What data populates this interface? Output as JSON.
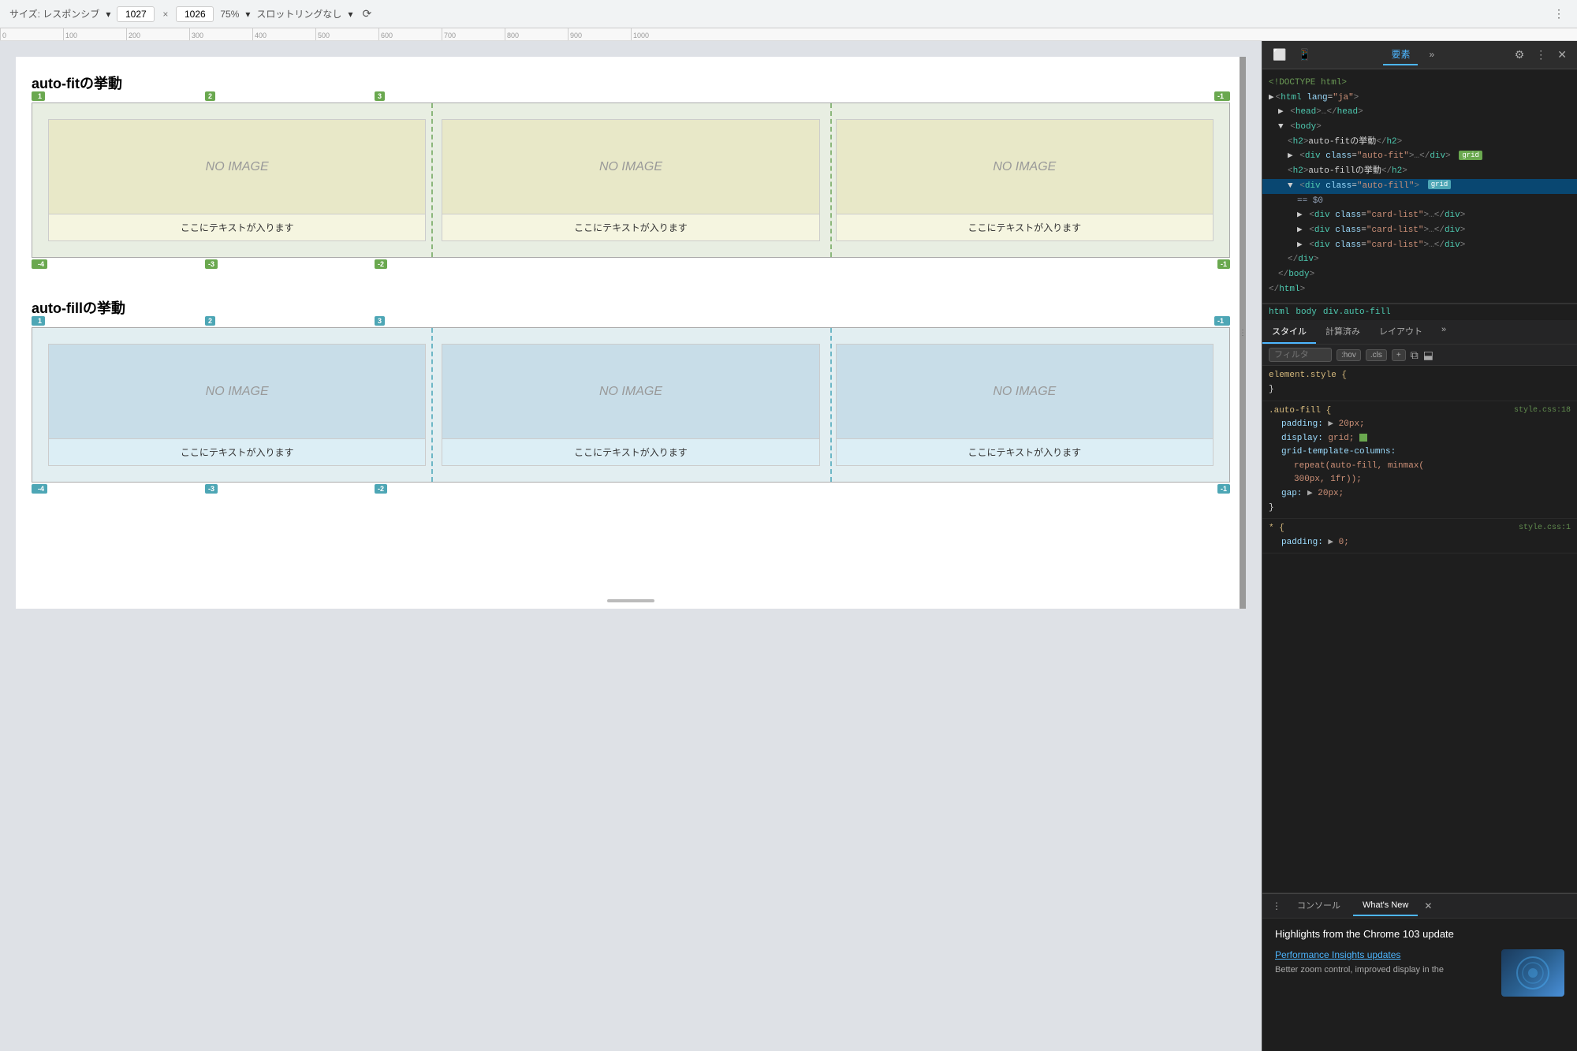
{
  "toolbar": {
    "size_label": "サイズ: レスポンシブ",
    "width_value": "1027",
    "height_value": "1026",
    "zoom_label": "75%",
    "slot_label": "スロットリングなし",
    "separator": "×"
  },
  "preview": {
    "section1_title": "auto-fitの挙動",
    "section2_title": "auto-fillの挙動",
    "card_placeholder": "NO IMAGE",
    "card_text": "ここにテキストが入ります"
  },
  "devtools": {
    "tabs": [
      "要素",
      "»"
    ],
    "icons": [
      "inspect",
      "devices",
      "settings",
      "more",
      "close"
    ],
    "html_lines": [
      "<!DOCTYPE html>",
      "<html lang=\"ja\">",
      "▶ <head>…</head>",
      "▼ <body>",
      "  <h2>auto-fitの挙動</h2>",
      "  ▶ <div class=\"auto-fit\">…</div>",
      "  <h2>auto-fillの挙動</h2>",
      "  ▼ <div class=\"auto-fill\">",
      "    == $0",
      "    ▶ <div class=\"card-list\">…</div>",
      "    ▶ <div class=\"card-list\">…</div>",
      "    ▶ <div class=\"card-list\">…</div>",
      "  </div>",
      "  </body>",
      "</html>"
    ],
    "breadcrumb": [
      "html",
      "body",
      "div.auto-fill"
    ],
    "styles_tabs": [
      "スタイル",
      "計算済み",
      "レイアウト",
      "»"
    ],
    "filter_placeholder": "フィルタ",
    "filter_badges": [
      ":hov",
      ".cls",
      "+"
    ],
    "style_rules": [
      {
        "selector": "element.style {",
        "properties": [],
        "closing": "}",
        "source": ""
      },
      {
        "selector": ".auto-fill {",
        "properties": [
          {
            "name": "padding:",
            "value": "▶ 20px;"
          },
          {
            "name": "display:",
            "value": "grid; ▪"
          },
          {
            "name": "grid-template-columns:",
            "value": ""
          },
          {
            "name": "  repeat(auto-fill, minmax(",
            "value": ""
          },
          {
            "name": "  300px, 1fr));",
            "value": ""
          },
          {
            "name": "gap:",
            "value": "▶ 20px;"
          }
        ],
        "closing": "}",
        "source": "style.css:18"
      },
      {
        "selector": "* {",
        "properties": [
          {
            "name": "padding:",
            "value": "▶ 0;"
          }
        ],
        "closing": "",
        "source": "style.css:1"
      }
    ]
  },
  "bottom_panel": {
    "tabs": [
      "コンソール",
      "What's New"
    ],
    "whats_new": {
      "title": "Highlights from the Chrome 103 update",
      "feature_title": "Performance Insights updates",
      "feature_desc": "Better zoom control, improved display in the"
    }
  }
}
